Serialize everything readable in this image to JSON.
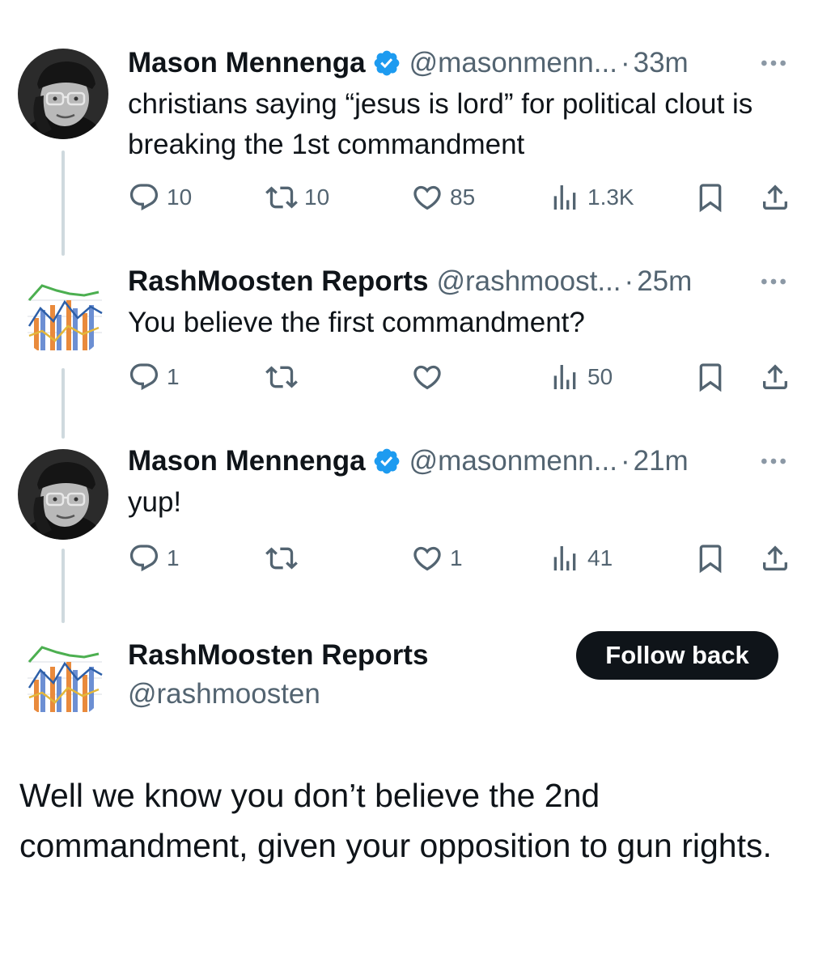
{
  "colors": {
    "text": "#0f1419",
    "secondary": "#536471",
    "verified": "#1d9bf0",
    "thread_line": "#cfd9de",
    "button_bg": "#0f1419",
    "button_text": "#ffffff"
  },
  "tweets": [
    {
      "name": "Mason Mennenga",
      "verified": true,
      "handle": "@masonmenn...",
      "dot": "·",
      "time": "33m",
      "text": "christians saying “jesus is lord” for political clout is breaking the 1st commandment",
      "replies": "10",
      "reposts": "10",
      "likes": "85",
      "views": "1.3K"
    },
    {
      "name": "RashMoosten Reports",
      "verified": false,
      "handle": "@rashmoost...",
      "dot": "·",
      "time": "25m",
      "text": "You believe the first commandment?",
      "replies": "1",
      "reposts": "",
      "likes": "",
      "views": "50"
    },
    {
      "name": "Mason Mennenga",
      "verified": true,
      "handle": "@masonmenn...",
      "dot": "·",
      "time": "21m",
      "text": "yup!",
      "replies": "1",
      "reposts": "",
      "likes": "1",
      "views": "41"
    }
  ],
  "reply_compose": {
    "name": "RashMoosten Reports",
    "handle": "@rashmoosten",
    "follow_button": "Follow back",
    "text": "Well we know you don’t believe the 2nd commandment, given your opposition to gun rights."
  },
  "icons": {
    "reply": "reply-icon",
    "repost": "repost-icon",
    "like": "like-icon",
    "views": "views-icon",
    "bookmark": "bookmark-icon",
    "share": "share-icon",
    "more": "more-icon",
    "verified": "verified-badge-icon"
  }
}
